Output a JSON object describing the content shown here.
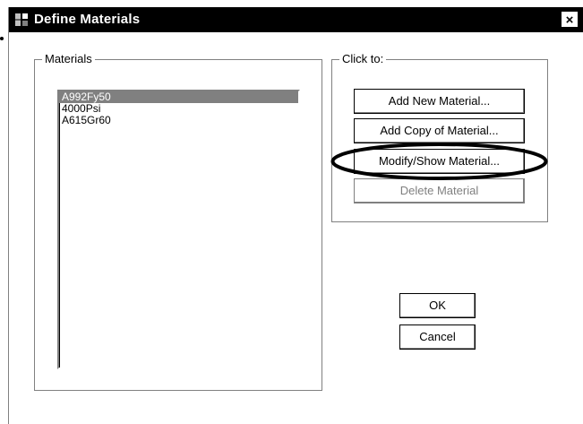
{
  "window": {
    "title": "Define Materials",
    "close_label": "×",
    "app_icon": "etabs-app-icon"
  },
  "materials_group": {
    "label": "Materials",
    "items": [
      {
        "label": "A992Fy50",
        "selected": true
      },
      {
        "label": "4000Psi",
        "selected": false
      },
      {
        "label": "A615Gr60",
        "selected": false
      }
    ]
  },
  "click_group": {
    "label": "Click to:",
    "add_new_label": "Add New Material...",
    "add_copy_label": "Add Copy of Material...",
    "modify_label": "Modify/Show Material...",
    "delete_label": "Delete Material",
    "delete_enabled": false,
    "highlighted_button": "modify"
  },
  "actions": {
    "ok_label": "OK",
    "cancel_label": "Cancel"
  },
  "colors": {
    "title_bar": "#000000",
    "selection": "#808080",
    "disabled_text": "#808080"
  }
}
